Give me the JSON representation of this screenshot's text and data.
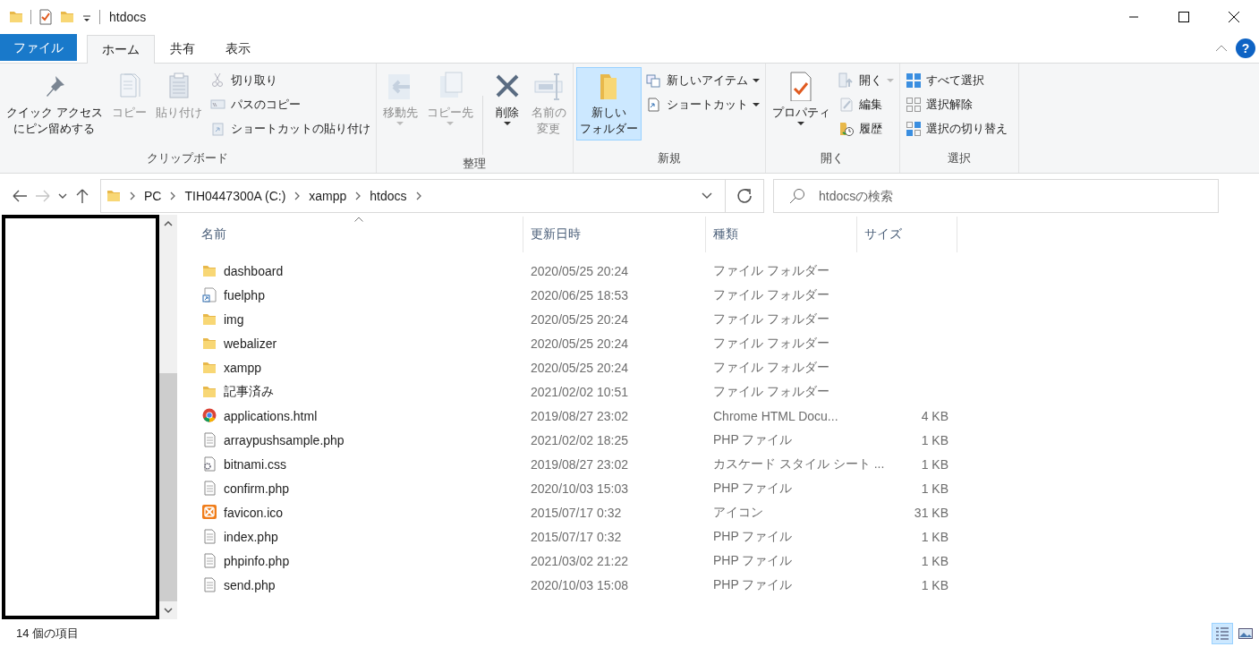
{
  "window": {
    "title": "htdocs"
  },
  "tabs": [
    {
      "label": "ファイル",
      "kind": "file",
      "selected": false
    },
    {
      "label": "ホーム",
      "kind": "tab",
      "selected": true
    },
    {
      "label": "共有",
      "kind": "tab",
      "selected": false
    },
    {
      "label": "表示",
      "kind": "tab",
      "selected": false
    }
  ],
  "ribbon": {
    "help_button": "?",
    "groups": [
      {
        "label": "クリップボード",
        "items": [
          {
            "kind": "large",
            "lines": [
              "クイック アクセス",
              "にピン留めする"
            ],
            "disabled": false,
            "dropdown": false,
            "highlighted": false
          },
          {
            "kind": "large",
            "lines": [
              "コピー"
            ],
            "disabled": true,
            "dropdown": false,
            "highlighted": false
          },
          {
            "kind": "large",
            "lines": [
              "貼り付け"
            ],
            "disabled": true,
            "dropdown": false,
            "highlighted": false
          },
          {
            "kind": "small",
            "label": "切り取り",
            "disabled": true,
            "dropdown": false
          },
          {
            "kind": "small",
            "label": "パスのコピー",
            "disabled": true,
            "dropdown": false
          },
          {
            "kind": "small",
            "label": "ショートカットの貼り付け",
            "disabled": true,
            "dropdown": false
          }
        ]
      },
      {
        "label": "整理",
        "items": [
          {
            "kind": "large",
            "lines": [
              "移動先"
            ],
            "disabled": true,
            "dropdown": true,
            "highlighted": false
          },
          {
            "kind": "large",
            "lines": [
              "コピー先"
            ],
            "disabled": true,
            "dropdown": true,
            "highlighted": false
          },
          {
            "kind": "large",
            "lines": [
              "削除"
            ],
            "disabled": false,
            "dropdown": true,
            "highlighted": false
          },
          {
            "kind": "large",
            "lines": [
              "名前の",
              "変更"
            ],
            "disabled": true,
            "dropdown": false,
            "highlighted": false
          }
        ]
      },
      {
        "label": "新規",
        "items": [
          {
            "kind": "large",
            "lines": [
              "新しい",
              "フォルダー"
            ],
            "disabled": false,
            "dropdown": false,
            "highlighted": true
          },
          {
            "kind": "small",
            "label": "新しいアイテム",
            "disabled": false,
            "dropdown": true
          },
          {
            "kind": "small",
            "label": "ショートカット",
            "disabled": false,
            "dropdown": true
          }
        ]
      },
      {
        "label": "開く",
        "items": [
          {
            "kind": "large",
            "lines": [
              "プロパティ"
            ],
            "disabled": false,
            "dropdown": true,
            "highlighted": false
          },
          {
            "kind": "small",
            "label": "開く",
            "disabled": true,
            "dropdown": true
          },
          {
            "kind": "small",
            "label": "編集",
            "disabled": true,
            "dropdown": false
          },
          {
            "kind": "small",
            "label": "履歴",
            "disabled": false,
            "dropdown": false
          }
        ]
      },
      {
        "label": "選択",
        "items": [
          {
            "kind": "small",
            "label": "すべて選択",
            "disabled": false,
            "dropdown": false
          },
          {
            "kind": "small",
            "label": "選択解除",
            "disabled": false,
            "dropdown": false
          },
          {
            "kind": "small",
            "label": "選択の切り替え",
            "disabled": false,
            "dropdown": false
          }
        ]
      }
    ]
  },
  "address": {
    "back_disabled": false,
    "forward_disabled": true,
    "path": [
      "PC",
      "TIH0447300A (C:)",
      "xampp",
      "htdocs"
    ]
  },
  "search": {
    "placeholder": "htdocsの検索"
  },
  "file_list": {
    "columns": [
      {
        "label": "名前",
        "sorted": true
      },
      {
        "label": "更新日時",
        "sorted": false
      },
      {
        "label": "種類",
        "sorted": false
      },
      {
        "label": "サイズ",
        "sorted": false
      }
    ],
    "rows": [
      {
        "kind": "folder",
        "name": "dashboard",
        "modified": "2020/05/25 20:24",
        "type": "ファイル フォルダー",
        "size": ""
      },
      {
        "kind": "folder-shortcut",
        "name": "fuelphp",
        "modified": "2020/06/25 18:53",
        "type": "ファイル フォルダー",
        "size": ""
      },
      {
        "kind": "folder",
        "name": "img",
        "modified": "2020/05/25 20:24",
        "type": "ファイル フォルダー",
        "size": ""
      },
      {
        "kind": "folder",
        "name": "webalizer",
        "modified": "2020/05/25 20:24",
        "type": "ファイル フォルダー",
        "size": ""
      },
      {
        "kind": "folder",
        "name": "xampp",
        "modified": "2020/05/25 20:24",
        "type": "ファイル フォルダー",
        "size": ""
      },
      {
        "kind": "folder",
        "name": "記事済み",
        "modified": "2021/02/02 10:51",
        "type": "ファイル フォルダー",
        "size": ""
      },
      {
        "kind": "web-page",
        "name": "applications.html",
        "modified": "2019/08/27 23:02",
        "type": "Chrome HTML Docu...",
        "size": "4 KB"
      },
      {
        "kind": "document",
        "name": "arraypushsample.php",
        "modified": "2021/02/02 18:25",
        "type": "PHP ファイル",
        "size": "1 KB"
      },
      {
        "kind": "stylesheet",
        "name": "bitnami.css",
        "modified": "2019/08/27 23:02",
        "type": "カスケード スタイル シート ...",
        "size": "1 KB"
      },
      {
        "kind": "document",
        "name": "confirm.php",
        "modified": "2020/10/03 15:03",
        "type": "PHP ファイル",
        "size": "1 KB"
      },
      {
        "kind": "app-icon",
        "name": "favicon.ico",
        "modified": "2015/07/17 0:32",
        "type": "アイコン",
        "size": "31 KB"
      },
      {
        "kind": "document",
        "name": "index.php",
        "modified": "2015/07/17 0:32",
        "type": "PHP ファイル",
        "size": "1 KB"
      },
      {
        "kind": "document",
        "name": "phpinfo.php",
        "modified": "2021/03/02 21:22",
        "type": "PHP ファイル",
        "size": "1 KB"
      },
      {
        "kind": "document",
        "name": "send.php",
        "modified": "2020/10/03 15:08",
        "type": "PHP ファイル",
        "size": "1 KB"
      }
    ]
  },
  "status_bar": {
    "count": "14 個の項目",
    "views": [
      {
        "kind": "details",
        "selected": true
      },
      {
        "kind": "large-icons",
        "selected": false
      }
    ]
  }
}
